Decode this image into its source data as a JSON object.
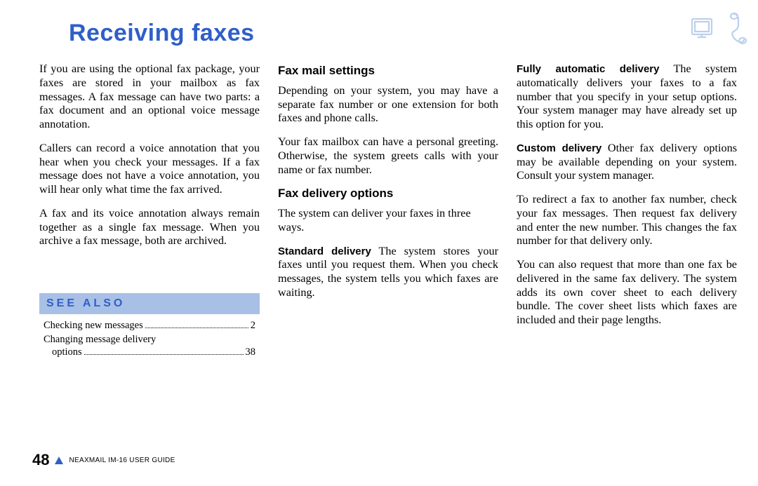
{
  "heading": "Receiving faxes",
  "col1": {
    "p1": "If you are using the optional fax package, your faxes are stored in your mailbox as fax messages. A fax message can have two parts: a fax document and an optional voice message annotation.",
    "p2": "Callers can record a voice annotation that you hear when you check your mes­sages. If a fax message does not have a voice annotation, you will hear only what time the fax arrived.",
    "p3": "A fax and its voice annotation always remain together as a single fax message. When you archive a fax message, both are archived.",
    "seealso_label": "SEE ALSO",
    "toc1_label": "Checking new messages",
    "toc1_page": "2",
    "toc2_label1": "Changing message delivery",
    "toc2_label2": "options",
    "toc2_page": "38"
  },
  "col2": {
    "h1": "Fax mail settings",
    "p1": "Depending on your system, you may have a separate fax number or one extension for both faxes and phone calls.",
    "p2": "Your fax mailbox can have a personal greeting. Otherwise, the system greets calls with your name or fax number.",
    "h2": "Fax delivery options",
    "p3": "The system can deliver your faxes in three ways.",
    "d1t": "Standard delivery",
    "d1b": "  The system stores your faxes until you request them. When you check messages, the sys­tem tells you which faxes are waiting."
  },
  "col3": {
    "d2t": "Fully automatic delivery",
    "d2b": "  The system automatically delivers your faxes to a fax number that you specify in your setup options. Your system manager may have already set up this option for you.",
    "d3t": "Custom delivery",
    "d3b": "  Other fax delivery options may be available depending on your system. Consult your system manager.",
    "p1": "To redirect a fax to another fax number, check your fax messages. Then request fax delivery and enter the new number. This changes the fax number for that delivery only.",
    "p2": "You can also request that more than one fax be delivered in the same fax delivery. The system adds its own cover sheet to each delivery bundle. The cover sheet lists which faxes are included and their page lengths."
  },
  "footer": {
    "page": "48",
    "guide": "NEAXMAIL IM-16 USER GUIDE"
  }
}
